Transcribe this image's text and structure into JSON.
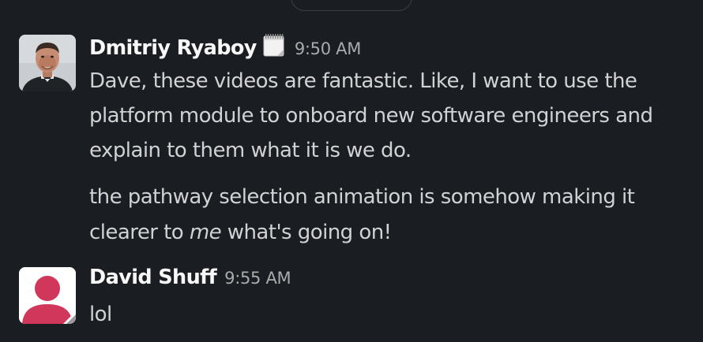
{
  "messages": [
    {
      "sender": "Dmitriy Ryaboy",
      "status_icon": "calendar-icon",
      "time": "9:50 AM",
      "paragraphs": [
        [
          "Dave, these videos are fantastic. Like, I want to use the",
          "platform module to onboard new software engineers and",
          "explain to them what it is we do."
        ],
        [
          "the pathway selection animation is somehow making it",
          {
            "before": "clearer to ",
            "emphasis": "me",
            "after": " what's going on!"
          }
        ]
      ]
    },
    {
      "sender": "David Shuff",
      "time": "9:55 AM",
      "avatar_color": "#d1375b",
      "text": "lol"
    }
  ]
}
